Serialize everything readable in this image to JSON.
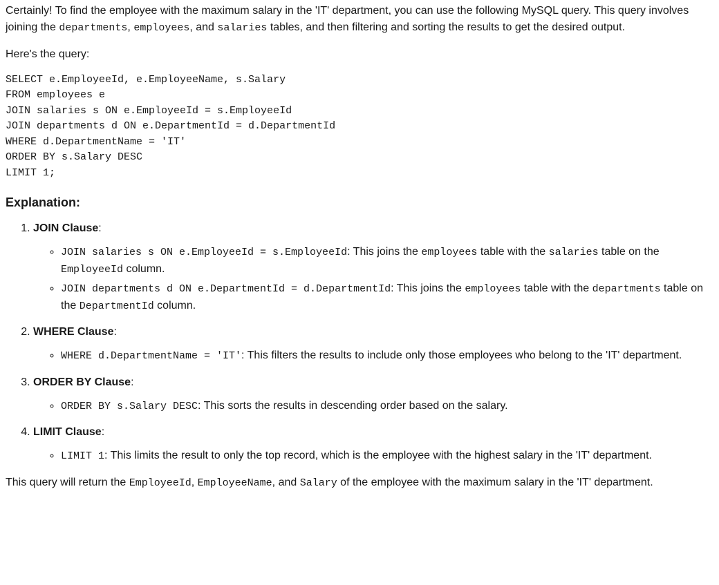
{
  "intro": {
    "p1_parts": [
      {
        "t": "text",
        "v": "Certainly! To find the employee with the maximum salary in the 'IT' department, you can use the following MySQL query. This query involves joining the "
      },
      {
        "t": "code",
        "v": "departments"
      },
      {
        "t": "text",
        "v": ", "
      },
      {
        "t": "code",
        "v": "employees"
      },
      {
        "t": "text",
        "v": ", and "
      },
      {
        "t": "code",
        "v": "salaries"
      },
      {
        "t": "text",
        "v": " tables, and then filtering and sorting the results to get the desired output."
      }
    ],
    "p2": "Here's the query:"
  },
  "code_block": "SELECT e.EmployeeId, e.EmployeeName, s.Salary\nFROM employees e\nJOIN salaries s ON e.EmployeeId = s.EmployeeId\nJOIN departments d ON e.DepartmentId = d.DepartmentId\nWHERE d.DepartmentName = 'IT'\nORDER BY s.Salary DESC\nLIMIT 1;",
  "explanation": {
    "heading": "Explanation:",
    "items": [
      {
        "title": "JOIN Clause",
        "subs": [
          [
            {
              "t": "code",
              "v": "JOIN salaries s ON e.EmployeeId = s.EmployeeId"
            },
            {
              "t": "text",
              "v": ": This joins the "
            },
            {
              "t": "code",
              "v": "employees"
            },
            {
              "t": "text",
              "v": " table with the "
            },
            {
              "t": "code",
              "v": "salaries"
            },
            {
              "t": "text",
              "v": " table on the "
            },
            {
              "t": "code",
              "v": "EmployeeId"
            },
            {
              "t": "text",
              "v": " column."
            }
          ],
          [
            {
              "t": "code",
              "v": "JOIN departments d ON e.DepartmentId = d.DepartmentId"
            },
            {
              "t": "text",
              "v": ": This joins the "
            },
            {
              "t": "code",
              "v": "employees"
            },
            {
              "t": "text",
              "v": " table with the "
            },
            {
              "t": "code",
              "v": "departments"
            },
            {
              "t": "text",
              "v": " table on the "
            },
            {
              "t": "code",
              "v": "DepartmentId"
            },
            {
              "t": "text",
              "v": " column."
            }
          ]
        ]
      },
      {
        "title": "WHERE Clause",
        "subs": [
          [
            {
              "t": "code",
              "v": "WHERE d.DepartmentName = 'IT'"
            },
            {
              "t": "text",
              "v": ": This filters the results to include only those employees who belong to the 'IT' department."
            }
          ]
        ]
      },
      {
        "title": "ORDER BY Clause",
        "subs": [
          [
            {
              "t": "code",
              "v": "ORDER BY s.Salary DESC"
            },
            {
              "t": "text",
              "v": ": This sorts the results in descending order based on the salary."
            }
          ]
        ]
      },
      {
        "title": "LIMIT Clause",
        "subs": [
          [
            {
              "t": "code",
              "v": "LIMIT 1"
            },
            {
              "t": "text",
              "v": ": This limits the result to only the top record, which is the employee with the highest salary in the 'IT' department."
            }
          ]
        ]
      }
    ]
  },
  "closing_parts": [
    {
      "t": "text",
      "v": "This query will return the "
    },
    {
      "t": "code",
      "v": "EmployeeId"
    },
    {
      "t": "text",
      "v": ", "
    },
    {
      "t": "code",
      "v": "EmployeeName"
    },
    {
      "t": "text",
      "v": ", and "
    },
    {
      "t": "code",
      "v": "Salary"
    },
    {
      "t": "text",
      "v": " of the employee with the maximum salary in the 'IT' department."
    }
  ]
}
